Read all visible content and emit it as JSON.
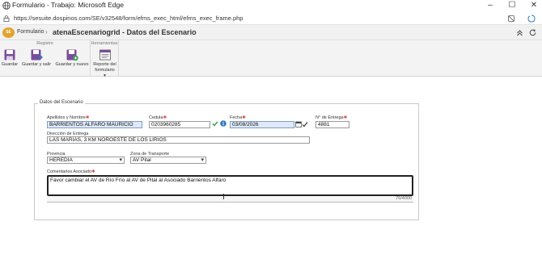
{
  "window": {
    "title": "Formulario - Trabajo: Microsoft Edge",
    "url": "https://sesuite.dospinos.com/SE/v32548/form/efms_exec_html/efms_exec_frame.php"
  },
  "header": {
    "logo_text": "SE",
    "breadcrumb_root": "Formulario",
    "separator": "›",
    "breadcrumb_current": "atenaEscenariogrid - Datos del Escenario"
  },
  "ribbon": {
    "groups": [
      {
        "title": "Registro",
        "buttons": [
          "Guardar",
          "Guardar y salir",
          "Guardar y nuevo"
        ]
      },
      {
        "title": "Herramientas",
        "buttons": [
          "Reporte del formulario"
        ]
      }
    ]
  },
  "form": {
    "section_title": "Datos del Escenario",
    "apellidos_label": "Apellidos y Nombre",
    "apellidos_value": "BARRIENTOS ALFARO MAURICIO",
    "cedula_label": "Cedula",
    "cedula_value": "0203960285",
    "fecha_label": "Fecha",
    "fecha_value": "03/08/2026",
    "entrega_label": "N° de Entrega",
    "entrega_value": "4881",
    "direccion_label": "Dirección de Entrega",
    "direccion_value": "LAS MARIAS, 3 KM NOROESTE DE LOS LIRIOS",
    "provincia_label": "Provincia",
    "provincia_value": "HEREDIA",
    "zona_label": "Zona de Transporte",
    "zona_value": "AV Pital",
    "comentarios_label": "Comentarios Asociado",
    "comentarios_value": "Favor cambiar el AV de Río Frío al AV de Pital al Asociado Barrientos Alfaro",
    "char_counter": "76/4000"
  },
  "colors": {
    "accent": "#2e7bbf",
    "logo": "#e0a32c",
    "required": "#e04a4a",
    "check": "#2e9d4b"
  }
}
